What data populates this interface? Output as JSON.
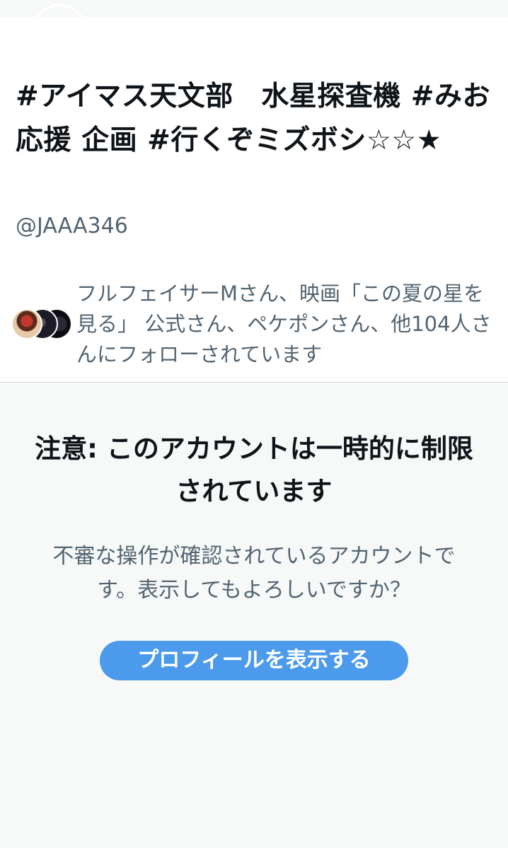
{
  "profile": {
    "display_name": "#アイマス天文部　水星探査機 #みお応援 企画 #行くぞミズボシ☆☆★",
    "handle": "@JAAA346",
    "followed_by": {
      "text": "フルフェイサーMさん、映画「この夏の星を見る」 公式さん、ペケポンさん、他104人さんにフォローされています",
      "avatars": [
        "avatar-follower-1",
        "avatar-follower-2",
        "avatar-follower-3"
      ]
    }
  },
  "warning": {
    "title": "注意: このアカウントは一時的に制限されています",
    "body": "不審な操作が確認されているアカウントです。表示してもよろしいですか？",
    "button_label": "プロフィールを表示する"
  },
  "colors": {
    "accent": "#4c9aeb",
    "secondary_text": "#536471",
    "panel_background": "#f7f9f9"
  }
}
